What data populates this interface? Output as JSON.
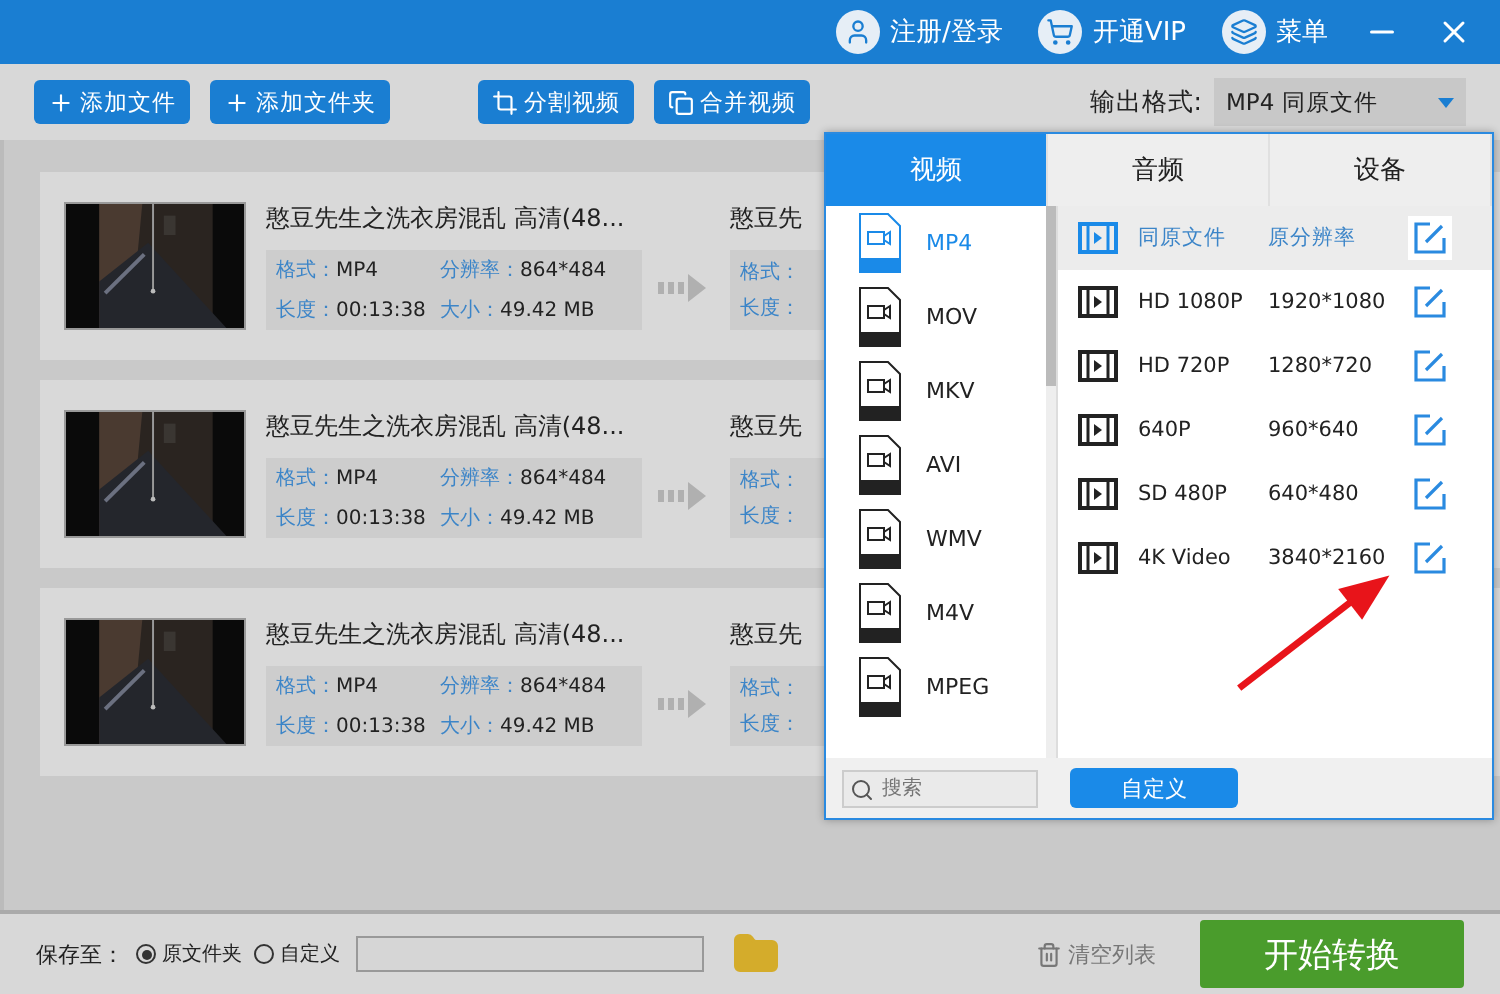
{
  "header": {
    "actions": [
      {
        "label": "注册/登录",
        "kind": "user"
      },
      {
        "label": "开通VIP",
        "kind": "cart"
      },
      {
        "label": "菜单",
        "kind": "layers"
      }
    ]
  },
  "toolbar": {
    "buttons": [
      {
        "label": "添加文件",
        "kind": "plus"
      },
      {
        "label": "添加文件夹",
        "kind": "plus"
      },
      {
        "label": "分割视频",
        "kind": "crop"
      },
      {
        "label": "合并视频",
        "kind": "merge"
      }
    ],
    "output_format": {
      "label": "输出格式:",
      "value": "MP4  同原文件"
    }
  },
  "files": [
    {
      "title": "憨豆先生之洗衣房混乱 高清(48...",
      "format_label": "格式：",
      "format": "MP4",
      "resolution_label": "分辨率：",
      "resolution": "864*484",
      "duration_label": "长度：",
      "duration": "00:13:38",
      "size_label": "大小：",
      "size": "49.42 MB",
      "output_title": "憨豆先",
      "output_format_label": "格式：",
      "output_duration_label": "长度："
    },
    {
      "title": "憨豆先生之洗衣房混乱 高清(48...",
      "format_label": "格式：",
      "format": "MP4",
      "resolution_label": "分辨率：",
      "resolution": "864*484",
      "duration_label": "长度：",
      "duration": "00:13:38",
      "size_label": "大小：",
      "size": "49.42 MB",
      "output_title": "憨豆先",
      "output_format_label": "格式：",
      "output_duration_label": "长度："
    },
    {
      "title": "憨豆先生之洗衣房混乱 高清(48...",
      "format_label": "格式：",
      "format": "MP4",
      "resolution_label": "分辨率：",
      "resolution": "864*484",
      "duration_label": "长度：",
      "duration": "00:13:38",
      "size_label": "大小：",
      "size": "49.42 MB",
      "output_title": "憨豆先",
      "output_format_label": "格式：",
      "output_duration_label": "长度："
    }
  ],
  "format_popup": {
    "tabs": [
      {
        "label": "视频",
        "selected": true
      },
      {
        "label": "音频",
        "selected": false
      },
      {
        "label": "设备",
        "selected": false
      }
    ],
    "formats": [
      {
        "label": "MP4",
        "selected": true
      },
      {
        "label": "MOV",
        "selected": false
      },
      {
        "label": "MKV",
        "selected": false
      },
      {
        "label": "AVI",
        "selected": false
      },
      {
        "label": "WMV",
        "selected": false
      },
      {
        "label": "M4V",
        "selected": false
      },
      {
        "label": "MPEG",
        "selected": false
      }
    ],
    "presets": [
      {
        "name": "同原文件",
        "resolution": "原分辨率",
        "selected": true
      },
      {
        "name": "HD 1080P",
        "resolution": "1920*1080",
        "selected": false
      },
      {
        "name": "HD 720P",
        "resolution": "1280*720",
        "selected": false
      },
      {
        "name": "640P",
        "resolution": "960*640",
        "selected": false
      },
      {
        "name": "SD 480P",
        "resolution": "640*480",
        "selected": false
      },
      {
        "name": "4K Video",
        "resolution": "3840*2160",
        "selected": false
      }
    ],
    "search": {
      "placeholder": "搜索"
    },
    "custom_button": "自定义"
  },
  "footer": {
    "save_label": "保存至：",
    "options": [
      {
        "label": "原文件夹",
        "selected": true
      },
      {
        "label": "自定义",
        "selected": false
      }
    ],
    "clear_button": "清空列表",
    "start_button": "开始转换"
  }
}
